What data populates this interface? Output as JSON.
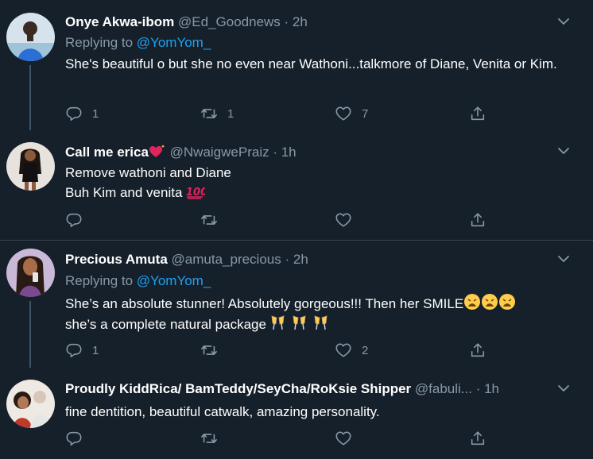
{
  "tweets": [
    {
      "name": "Onye Akwa-ibom",
      "handle": "@Ed_Goodnews",
      "time": "2h",
      "replying_label": "Replying to",
      "replying_to": "@YomYom_",
      "text": "She's beautiful o but she no even near Wathoni...talkmore of Diane, Venita or Kim.",
      "reply_count": "1",
      "retweet_count": "1",
      "like_count": "7"
    },
    {
      "name": "Call me erica",
      "handle": "@NwaigwePraiz",
      "time": "1h",
      "text_line1": "Remove wathoni and Diane",
      "text_line2": "Buh Kim and venita",
      "reply_count": "",
      "retweet_count": "",
      "like_count": ""
    },
    {
      "name": "Precious Amuta",
      "handle": "@amuta_precious",
      "time": "2h",
      "replying_label": "Replying to",
      "replying_to": "@YomYom_",
      "text_line1": "She’s an absolute stunner! Absolutely gorgeous!!! Then her SMILE",
      "text_line2": "she’s a complete natural package",
      "reply_count": "1",
      "retweet_count": "",
      "like_count": "2"
    },
    {
      "name": "Proudly KiddRica/ BamTeddy/SeyCha/RoKsie Shipper",
      "handle": "@fabuli...",
      "time": "1h",
      "text": "fine dentition, beautiful catwalk, amazing personality.",
      "reply_count": "",
      "retweet_count": "",
      "like_count": ""
    }
  ],
  "separator": " · ",
  "icons": [
    "reply-icon",
    "retweet-icon",
    "like-icon",
    "share-icon",
    "chevron-down-icon",
    "sparkling-heart-emoji",
    "hundred-points-emoji",
    "weary-face-emoji",
    "clinking-glasses-emoji"
  ],
  "colors": {
    "background": "#15202b",
    "divider": "#38444d",
    "secondary_text": "#8899a6",
    "link": "#1da1f2"
  }
}
